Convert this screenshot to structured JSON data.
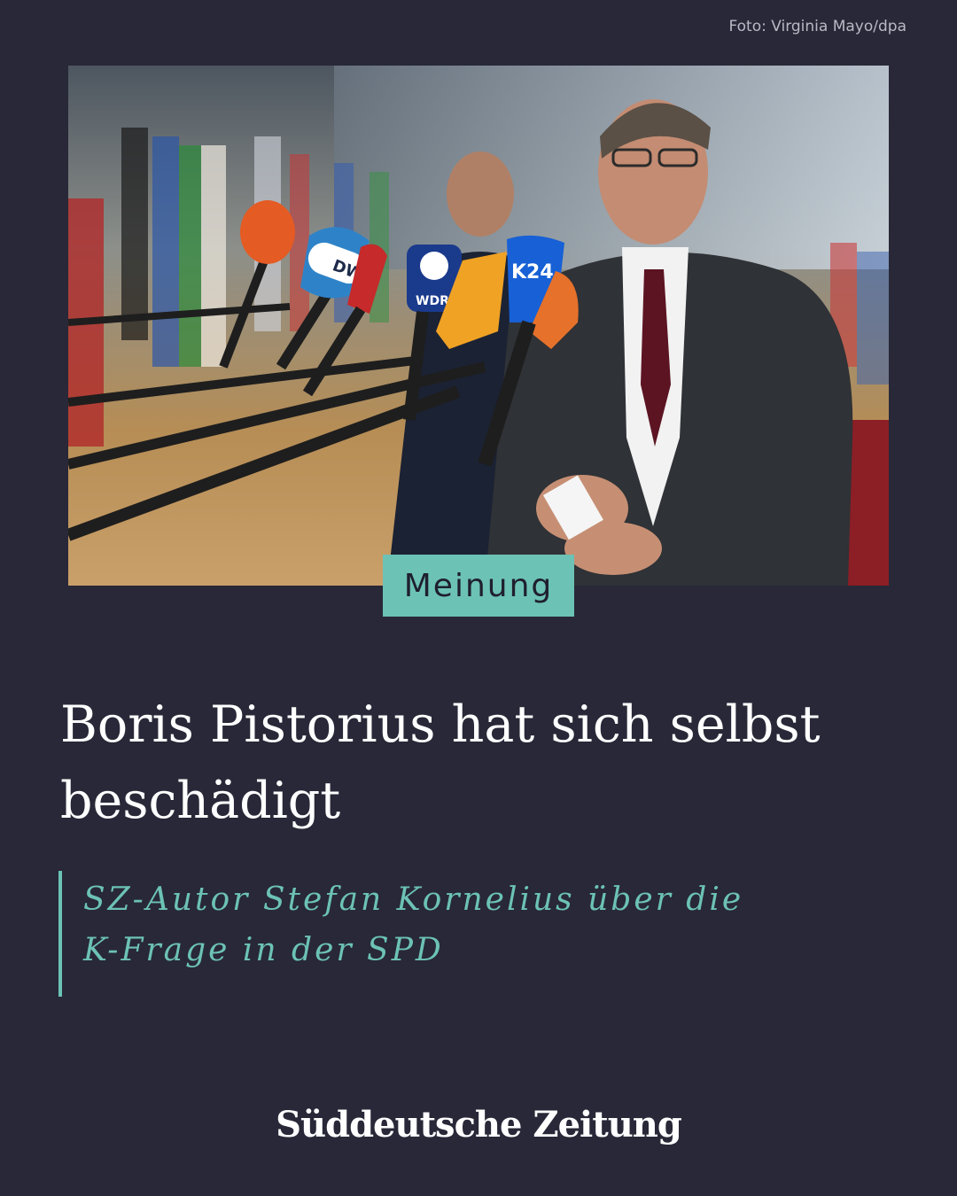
{
  "photo_credit": "Foto: Virginia Mayo/dpa",
  "photo": {
    "alt": "Man in dark suit speaking to reporters in front of a bank of microphones with flags in the background",
    "mic_labels": [
      "DW",
      "WDR",
      "K24"
    ]
  },
  "badge": "Meinung",
  "headline": "Boris Pistorius hat sich selbst beschädigt",
  "subline": "SZ-Autor Stefan Kornelius über die K-Frage in der SPD",
  "brand": "Süddeutsche Zeitung",
  "colors": {
    "background": "#282838",
    "accent": "#6cc2b5",
    "text": "#ffffff"
  }
}
